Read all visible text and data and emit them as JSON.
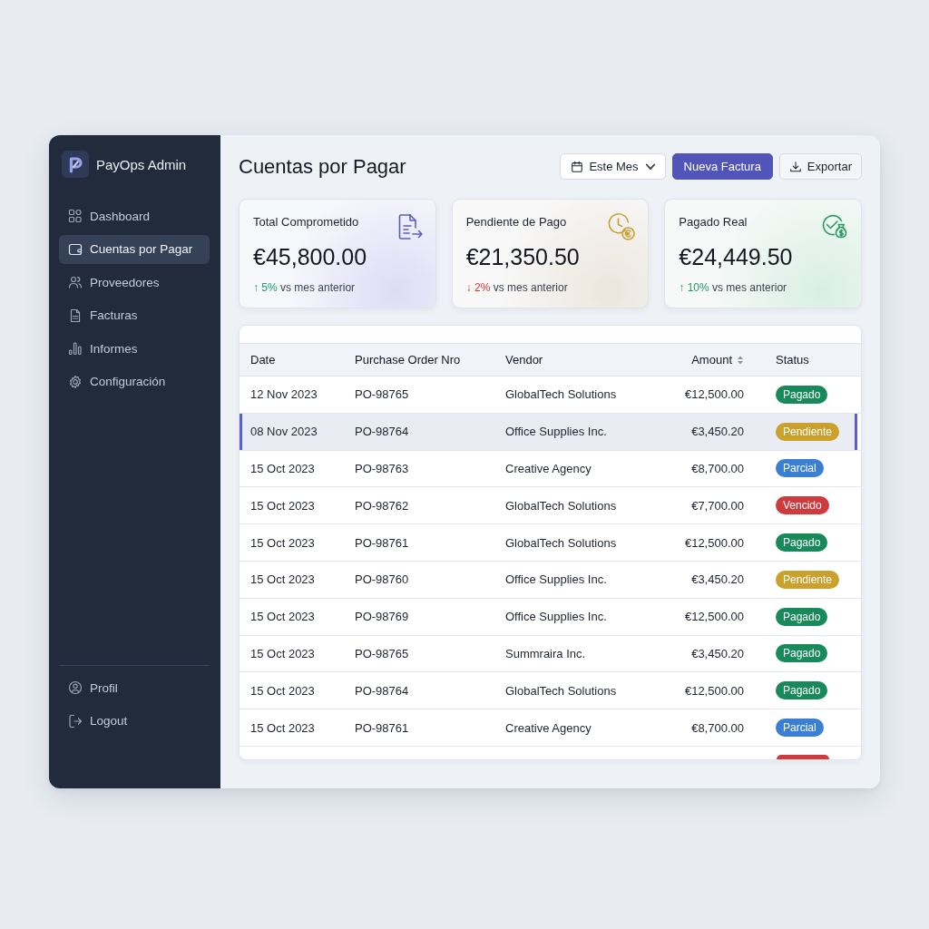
{
  "sidebar": {
    "brand": "PayOps Admin",
    "nav": [
      {
        "label": "Dashboard",
        "selected": false
      },
      {
        "label": "Cuentas por Pagar",
        "selected": true
      },
      {
        "label": "Proveedores",
        "selected": false
      },
      {
        "label": "Facturas",
        "selected": false
      },
      {
        "label": "Informes",
        "selected": false
      },
      {
        "label": "Configuración",
        "selected": false
      }
    ],
    "footer_nav": [
      {
        "label": "Profil"
      },
      {
        "label": "Logout"
      }
    ]
  },
  "header": {
    "title": "Cuentas por Pagar",
    "period_select": {
      "value": "Este Mes"
    },
    "buttons": [
      {
        "label": "Nueva Factura",
        "kind": "primary"
      },
      {
        "label": "Exportar",
        "kind": "export"
      }
    ]
  },
  "kpis": [
    {
      "kind": "committed",
      "label": "Total Comprometido",
      "value": "€45,800.00",
      "increase": true,
      "change": "↑ 5%",
      "note": "vs mes anterior"
    },
    {
      "kind": "pending",
      "label": "Pendiente de Pago",
      "value": "€21,350.50",
      "increase": false,
      "change": "↓ 2%",
      "note": "vs mes anterior"
    },
    {
      "kind": "paid",
      "label": "Pagado Real",
      "value": "€24,449.50",
      "increase": true,
      "change": "↑ 10%",
      "note": "vs mes anterior"
    }
  ],
  "table": {
    "columns": [
      {
        "label": "Date",
        "sortable": false
      },
      {
        "label": "Purchase Order Nro",
        "sortable": false
      },
      {
        "label": "Vendor",
        "sortable": false
      },
      {
        "label": "Amount",
        "sortable": true
      },
      {
        "label": "Status",
        "sortable": false
      }
    ],
    "rows": [
      {
        "cells": [
          "12 Nov 2023",
          "PO-98765",
          "GlobalTech Solutions",
          "€12,500.00"
        ],
        "status": "Pagado",
        "color": "#17895a",
        "selected": false
      },
      {
        "cells": [
          "08 Nov 2023",
          "PO-98764",
          "Office Supplies Inc.",
          "€3,450.20"
        ],
        "status": "Pendiente",
        "color": "#c9a12c",
        "selected": true
      },
      {
        "cells": [
          "15 Oct 2023",
          "PO-98763",
          "Creative Agency",
          "€8,700.00"
        ],
        "status": "Parcial",
        "color": "#3a7fd4",
        "selected": false
      },
      {
        "cells": [
          "15 Oct 2023",
          "PO-98762",
          "GlobalTech Solutions",
          "€7,700.00"
        ],
        "status": "Vencido",
        "color": "#cf3a3d",
        "selected": false
      },
      {
        "cells": [
          "15 Oct 2023",
          "PO-98761",
          "GlobalTech Solutions",
          "€12,500.00"
        ],
        "status": "Pagado",
        "color": "#17895a",
        "selected": false
      },
      {
        "cells": [
          "15 Oct 2023",
          "PO-98760",
          "Office Supplies Inc.",
          "€3,450.20"
        ],
        "status": "Pendiente",
        "color": "#c9a12c",
        "selected": false
      },
      {
        "cells": [
          "15 Oct 2023",
          "PO-98769",
          "Office Supplies Inc.",
          "€12,500.00"
        ],
        "status": "Pagado",
        "color": "#17895a",
        "selected": false
      },
      {
        "cells": [
          "15 Oct 2023",
          "PO-98765",
          "Summraira Inc.",
          "€3,450.20"
        ],
        "status": "Pagado",
        "color": "#17895a",
        "selected": false
      },
      {
        "cells": [
          "15 Oct 2023",
          "PO-98764",
          "GlobalTech Solutions",
          "€12,500.00"
        ],
        "status": "Pagado",
        "color": "#17895a",
        "selected": false
      },
      {
        "cells": [
          "15 Oct 2023",
          "PO-98761",
          "Creative Agency",
          "€8,700.00"
        ],
        "status": "Parcial",
        "color": "#3a7fd4",
        "selected": false
      }
    ],
    "cut_row": {
      "color": "#cf3a3d"
    }
  }
}
